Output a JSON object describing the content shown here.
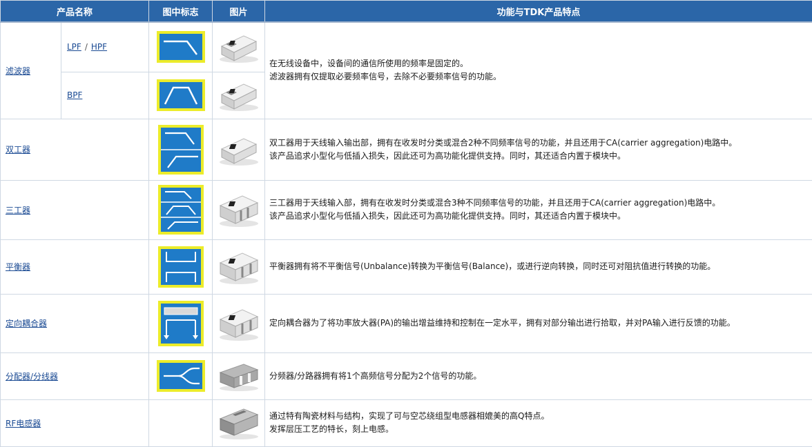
{
  "headers": {
    "name": "产品名称",
    "symbol": "图中标志",
    "photo": "图片",
    "features": "功能与TDK产品特点"
  },
  "filter": {
    "name": "滤波器",
    "lpf": "LPF",
    "slash": "/",
    "hpf": "HPF",
    "bpf": "BPF",
    "desc": [
      "在无线设备中，设备间的通信所使用的频率是固定的。",
      "滤波器拥有仅提取必要频率信号，去除不必要频率信号的功能。"
    ]
  },
  "diplexer": {
    "name": "双工器",
    "desc": [
      "双工器用于天线输入输出部，拥有在收发时分类或混合2种不同频率信号的功能，并且还用于CA(carrier aggregation)电路中。",
      "该产品追求小型化与低插入损失，因此还可为高功能化提供支持。同时，其还适合内置于模块中。"
    ]
  },
  "triplexer": {
    "name": "三工器",
    "desc": [
      "三工器用于天线输入部，拥有在收发时分类或混合3种不同频率信号的功能，并且还用于CA(carrier aggregation)电路中。",
      "该产品追求小型化与低插入损失，因此还可为高功能化提供支持。同时，其还适合内置于模块中。"
    ]
  },
  "balun": {
    "name": "平衡器",
    "desc": [
      "平衡器拥有将不平衡信号(Unbalance)转换为平衡信号(Balance)，或进行逆向转换，同时还可对阻抗值进行转换的功能。"
    ]
  },
  "coupler": {
    "name": "定向耦合器",
    "desc": [
      "定向耦合器为了将功率放大器(PA)的输出增益维持和控制在一定水平，拥有对部分输出进行拾取，并对PA输入进行反馈的功能。"
    ]
  },
  "divider": {
    "name": "分配器/分线器",
    "desc": [
      "分频器/分路器拥有将1个高频信号分配为2个信号的功能。"
    ]
  },
  "inductor": {
    "name": "RF电感器",
    "desc": [
      "通过特有陶瓷材料与结构，实现了可与空芯绕组型电感器相媲美的高Q特点。",
      "发挥层压工艺的特长，刻上电感。"
    ]
  },
  "colors": {
    "header_bg": "#2b66a8",
    "icon_blue": "#1f7bc8",
    "icon_border": "#ecec2a",
    "link": "#1a4a93"
  }
}
